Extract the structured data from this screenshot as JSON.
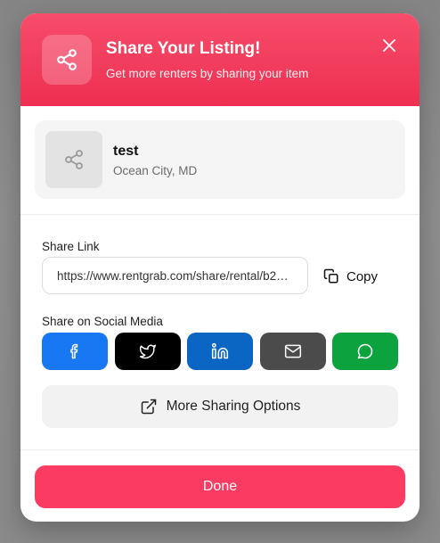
{
  "modal": {
    "title": "Share Your Listing!",
    "subtitle": "Get more renters by sharing your item"
  },
  "listing": {
    "title": "test",
    "location": "Ocean City, MD"
  },
  "share_link": {
    "label": "Share Link",
    "value": "https://www.rentgrab.com/share/rental/b2gpr...",
    "copy_label": "Copy"
  },
  "social": {
    "label": "Share on Social Media",
    "buttons": [
      {
        "name": "facebook",
        "icon": "facebook-icon",
        "color": "#1877f2"
      },
      {
        "name": "twitter",
        "icon": "twitter-icon",
        "color": "#000000"
      },
      {
        "name": "linkedin",
        "icon": "linkedin-icon",
        "color": "#0a66c2"
      },
      {
        "name": "email",
        "icon": "mail-icon",
        "color": "#4b4b4b"
      },
      {
        "name": "whatsapp",
        "icon": "whatsapp-icon",
        "color": "#0ca33f"
      }
    ]
  },
  "more_options_label": "More Sharing Options",
  "done_label": "Done",
  "colors": {
    "accent": "#fc3b62",
    "header_gradient_top": "#f74d6a",
    "header_gradient_bottom": "#ee2f52"
  }
}
